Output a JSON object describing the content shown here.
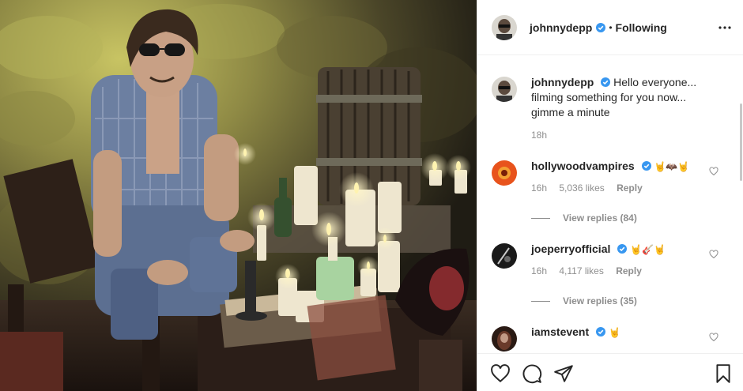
{
  "post": {
    "author": "johnnydepp",
    "follow_status": "Following",
    "separator": "•",
    "caption": "Hello everyone... filming something for you now... gimme a minute",
    "time": "18h"
  },
  "comments": [
    {
      "user": "hollywoodvampires",
      "verified": true,
      "text": "🤘🦇🤘",
      "time": "16h",
      "likes": "5,036 likes",
      "reply": "Reply",
      "view_replies": "View replies (84)",
      "avatar_color": "#e8531c"
    },
    {
      "user": "joeperryofficial",
      "verified": true,
      "text": "🤘🎸🤘",
      "time": "16h",
      "likes": "4,117 likes",
      "reply": "Reply",
      "view_replies": "View replies (35)",
      "avatar_color": "#1a1a1a"
    },
    {
      "user": "iamstevent",
      "verified": true,
      "text": "🤘",
      "avatar_color": "#2a1a14"
    }
  ],
  "icons": {
    "more": "more-options-icon",
    "verified": "verified-badge-icon",
    "like": "heart-icon",
    "comment": "comment-icon",
    "share": "share-icon",
    "save": "bookmark-icon"
  },
  "colors": {
    "verified": "#3897f0",
    "text": "#262626",
    "muted": "#8e8e8e",
    "border": "#efefef"
  }
}
